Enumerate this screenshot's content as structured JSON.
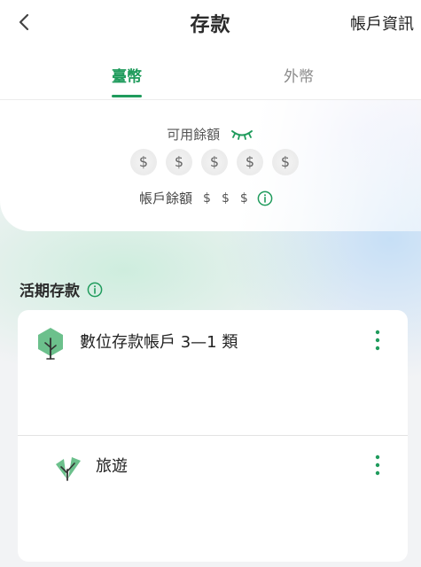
{
  "header": {
    "title": "存款",
    "account_info_label": "帳戶資訊"
  },
  "tabs": [
    {
      "label": "臺幣",
      "active": true
    },
    {
      "label": "外幣",
      "active": false
    }
  ],
  "balance": {
    "available_label": "可用餘額",
    "masked_digits": [
      "$",
      "$",
      "$",
      "$",
      "$"
    ],
    "account_balance_label": "帳戶餘額",
    "account_balance_masked": [
      "$",
      "$",
      "$"
    ]
  },
  "section": {
    "title": "活期存款"
  },
  "accounts": [
    {
      "name": "數位存款帳戶 3—1 類",
      "icon": "tree-hexagon-icon"
    },
    {
      "name": "旅遊",
      "icon": "leaf-sprout-icon"
    }
  ],
  "colors": {
    "accent": "#1f9b5c",
    "icon_green": "#6cc08c"
  }
}
